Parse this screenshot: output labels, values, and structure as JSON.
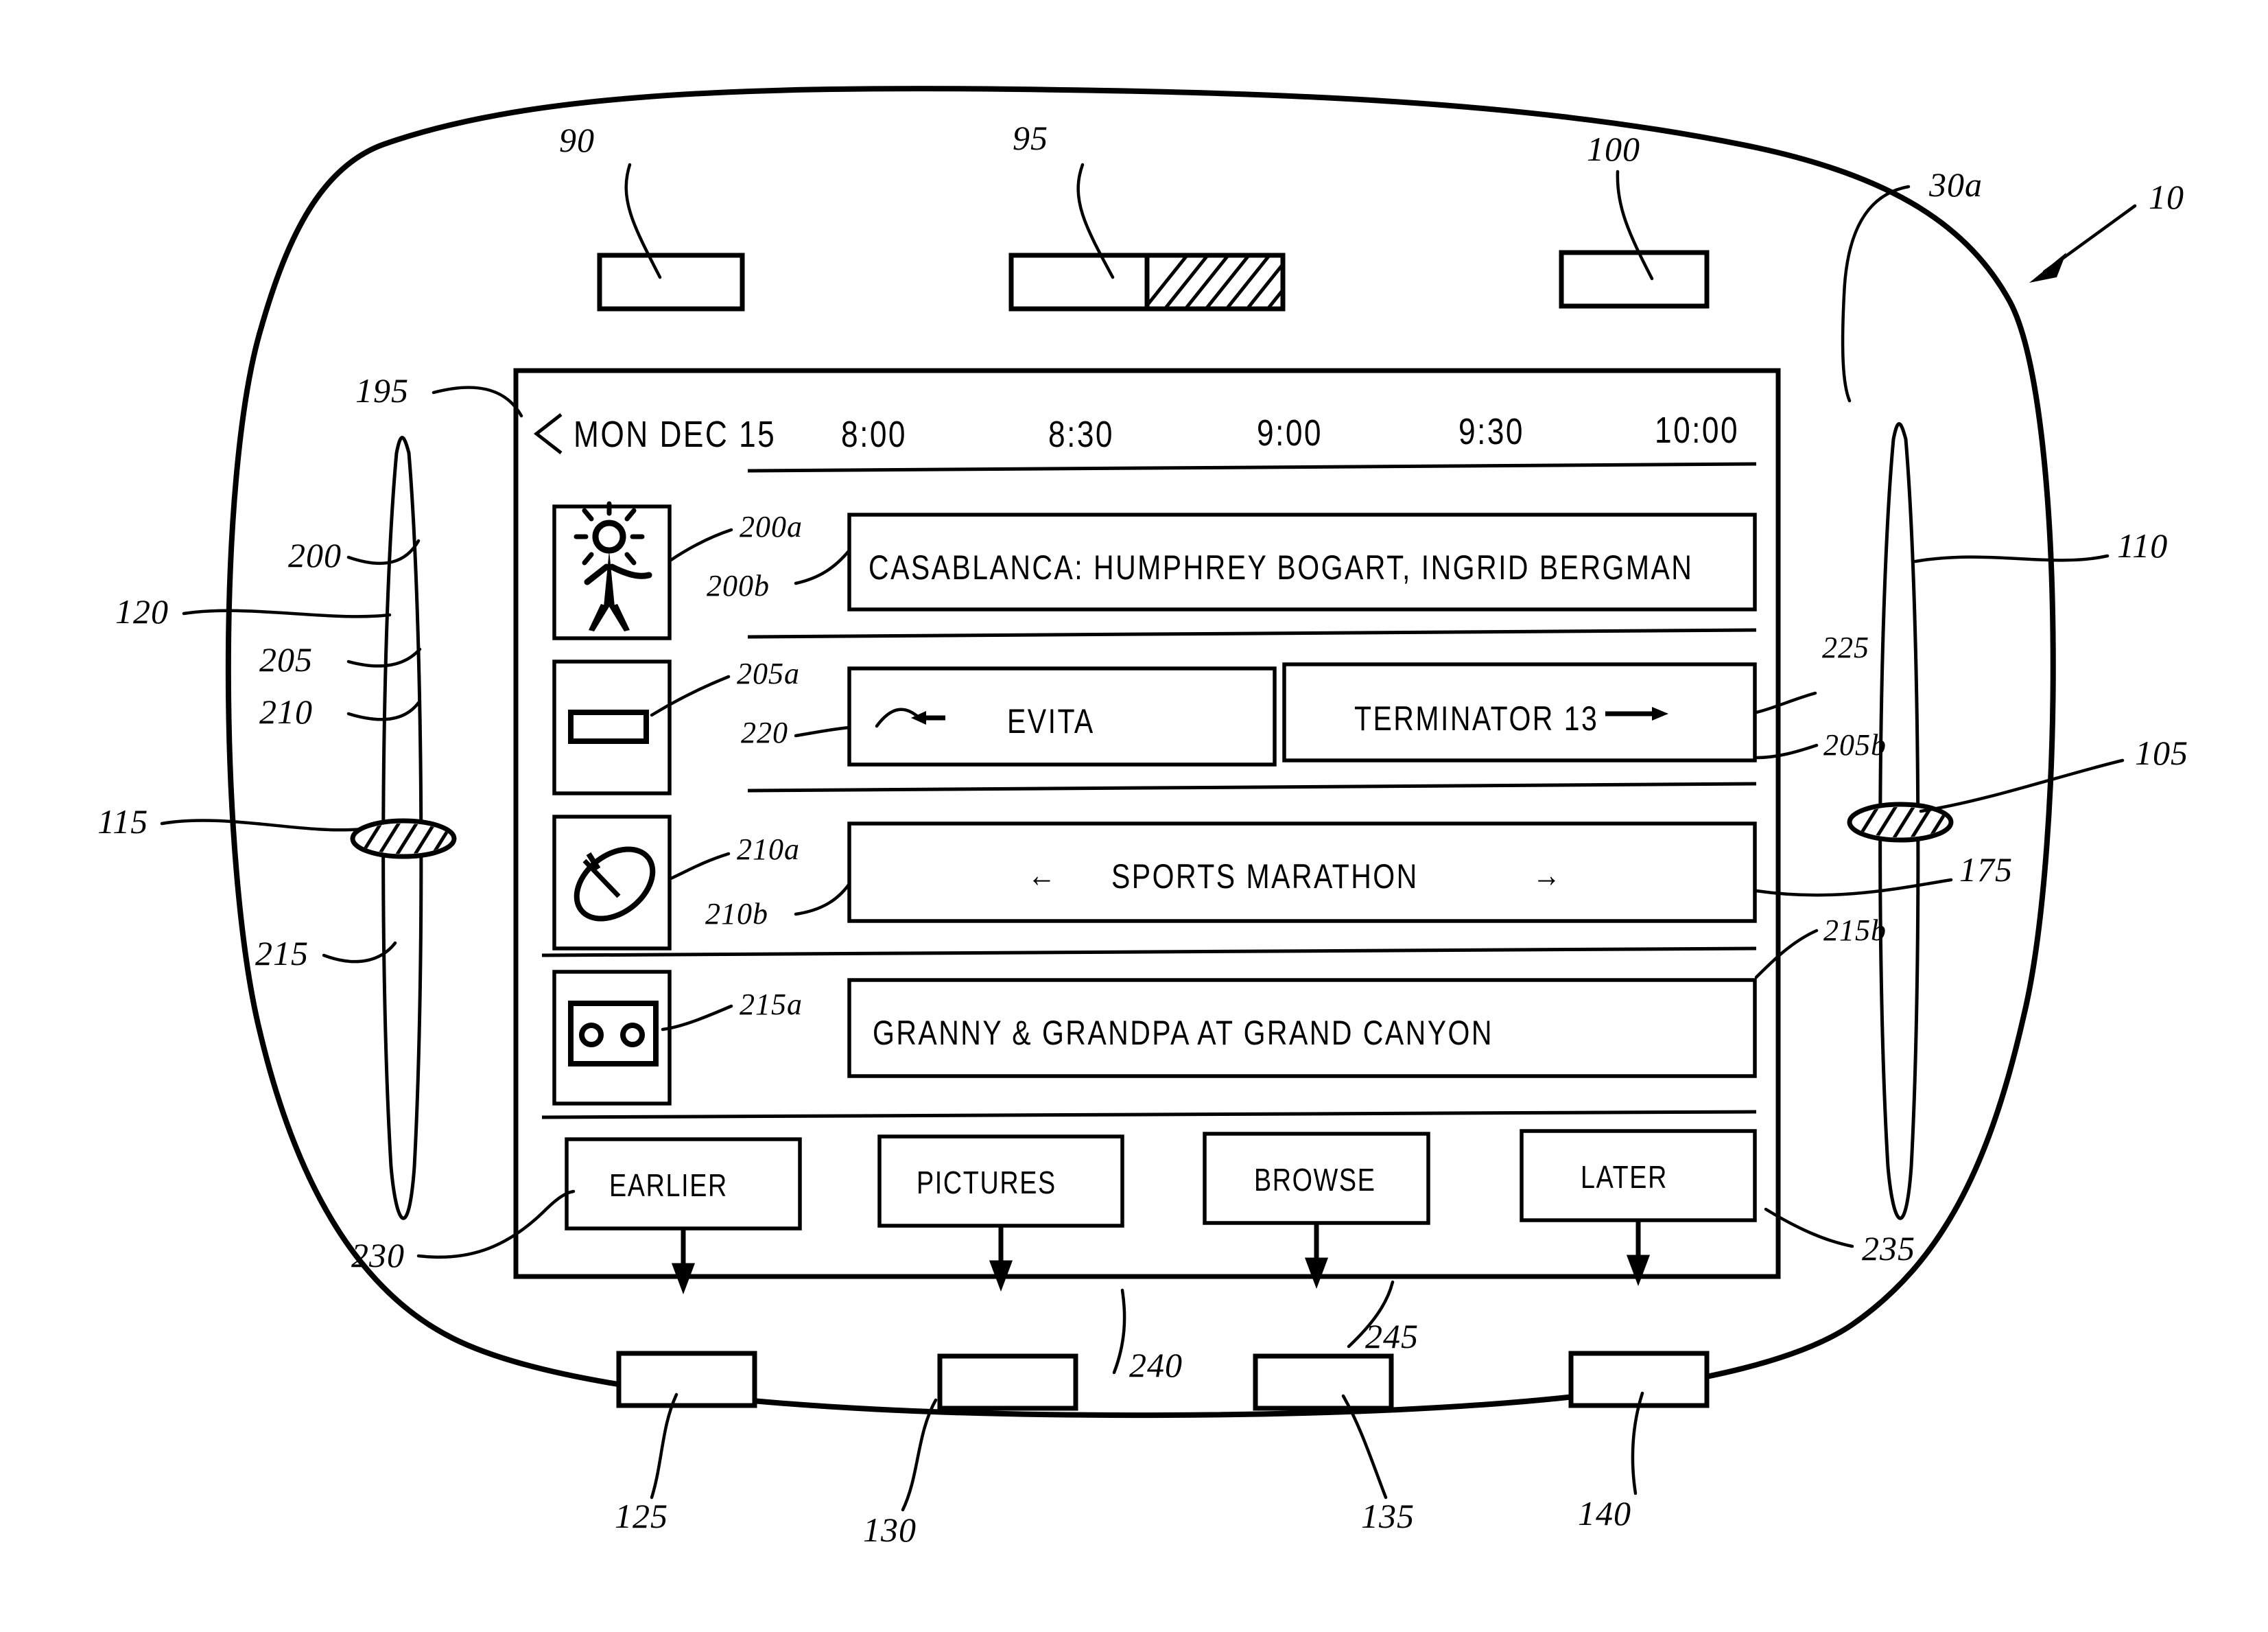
{
  "figure": {
    "device_ref": "10",
    "shell_ref": "30a",
    "screen_ref": "195"
  },
  "top_buttons": [
    {
      "ref": "90",
      "style": "plain"
    },
    {
      "ref": "95",
      "style": "half-hatched"
    },
    {
      "ref": "100",
      "style": "plain"
    }
  ],
  "bottom_buttons": [
    {
      "ref": "125"
    },
    {
      "ref": "130"
    },
    {
      "ref": "135"
    },
    {
      "ref": "140"
    }
  ],
  "sliders": {
    "left": {
      "ref_track": "120",
      "ref_thumb": "115"
    },
    "right": {
      "ref_track": "110",
      "ref_thumb": "105"
    }
  },
  "screen": {
    "back_chevron": "chevron-left-icon",
    "date": "MON DEC 15",
    "times": [
      "8:00",
      "8:30",
      "9:00",
      "9:30",
      "10:00"
    ],
    "rows": [
      {
        "icon": "person-star-icon",
        "icon_ref": "200a",
        "row_ref": "200",
        "cell_ref": "200b",
        "cells": [
          {
            "label": "CASABLANCA: HUMPHREY BOGART, INGRID BERGMAN",
            "span": "full"
          }
        ]
      },
      {
        "icon": "marquee-bar-icon",
        "icon_ref": "205a",
        "row_ref": "205",
        "cell_ref": "205b",
        "arrow_ref": "220",
        "right_ref": "225",
        "cells": [
          {
            "label": "EVITA",
            "span": "half"
          },
          {
            "label": "TERMINATOR 13",
            "span": "half"
          }
        ]
      },
      {
        "icon": "football-icon",
        "icon_ref": "210a",
        "row_ref": "210",
        "cell_ref": "210b",
        "cells": [
          {
            "label": "SPORTS MARATHON",
            "span": "full",
            "arrows": "both"
          }
        ]
      },
      {
        "icon": "videocassette-icon",
        "icon_ref": "215a",
        "row_ref": "215",
        "cell_ref": "215b",
        "cells": [
          {
            "label": "GRANNY & GRANDPA AT GRAND CANYON",
            "span": "full"
          }
        ]
      }
    ],
    "buttons": [
      {
        "label": "EARLIER",
        "ref": "230"
      },
      {
        "label": "PICTURES",
        "ref": "240"
      },
      {
        "label": "BROWSE",
        "ref": "245"
      },
      {
        "label": "LATER",
        "ref": "235"
      }
    ],
    "extra_refs": {
      "right_edge_175": "175"
    }
  },
  "glyphs": {
    "arrow_left": "←",
    "arrow_right": "→",
    "chevron_left": "<"
  }
}
